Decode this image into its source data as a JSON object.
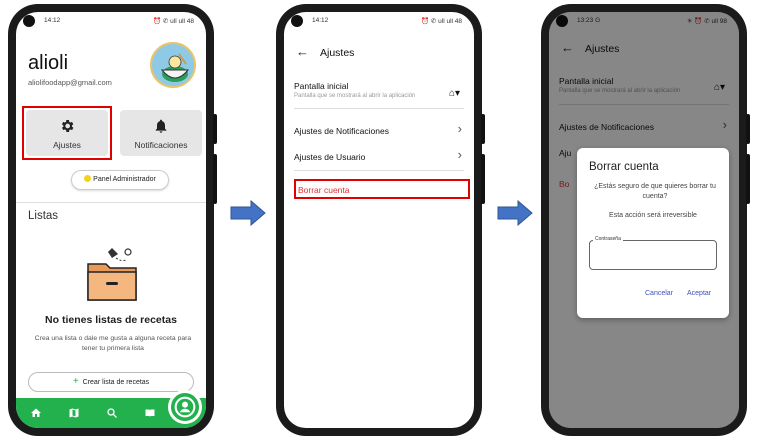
{
  "colors": {
    "brand_green": "#22b14c",
    "highlight_red": "#e00000",
    "delete_red": "#e03030",
    "arrow_blue": "#4472c4",
    "dialog_button_blue": "#3f51b5"
  },
  "phone1": {
    "status_time": "14:12",
    "status_icons": "⏰ ✆ ull ull 48",
    "user_name": "alioli",
    "user_email": "aliolifoodapp@gmail.com",
    "avatar_icon": "bowl-avatar-icon",
    "tiles": [
      {
        "label": "Ajustes",
        "icon": "gear-icon"
      },
      {
        "label": "Notificaciones",
        "icon": "bell-icon"
      }
    ],
    "admin_button": "Panel Administrador",
    "lists_heading": "Listas",
    "empty_title": "No tienes listas de recetas",
    "empty_desc": "Crea una lista o dale me gusta a alguna receta para tener tu primera lista",
    "create_button": "Crear lista de recetas",
    "nav_icons": [
      "home-icon",
      "map-icon",
      "search-icon",
      "book-icon",
      "profile-icon"
    ]
  },
  "phone2": {
    "status_time": "14:12",
    "status_icons": "⏰ ✆ ull ull 48",
    "title": "Ajustes",
    "start_screen_title": "Pantalla inicial",
    "start_screen_sub": "Pantalla que se mostrará al abrir la aplicación",
    "notif_settings": "Ajustes de Notificaciones",
    "user_settings": "Ajustes de Usuario",
    "delete_account": "Borrar cuenta"
  },
  "phone3": {
    "status_time": "13:23 G",
    "status_icons": "✳ ⏰ ✆ ull 98",
    "title": "Ajustes",
    "start_screen_title": "Pantalla inicial",
    "start_screen_sub": "Pantalla que se mostrará al abrir la aplicación",
    "notif_settings": "Ajustes de Notificaciones",
    "user_settings_partial": "Aju",
    "delete_partial": "Bo",
    "dialog": {
      "title": "Borrar cuenta",
      "question": "¿Estás seguro de que quieres borrar tu cuenta?",
      "warning": "Esta acción será irreversible",
      "password_label": "Contraseña",
      "password_value": "",
      "cancel": "Cancelar",
      "accept": "Aceptar"
    }
  }
}
